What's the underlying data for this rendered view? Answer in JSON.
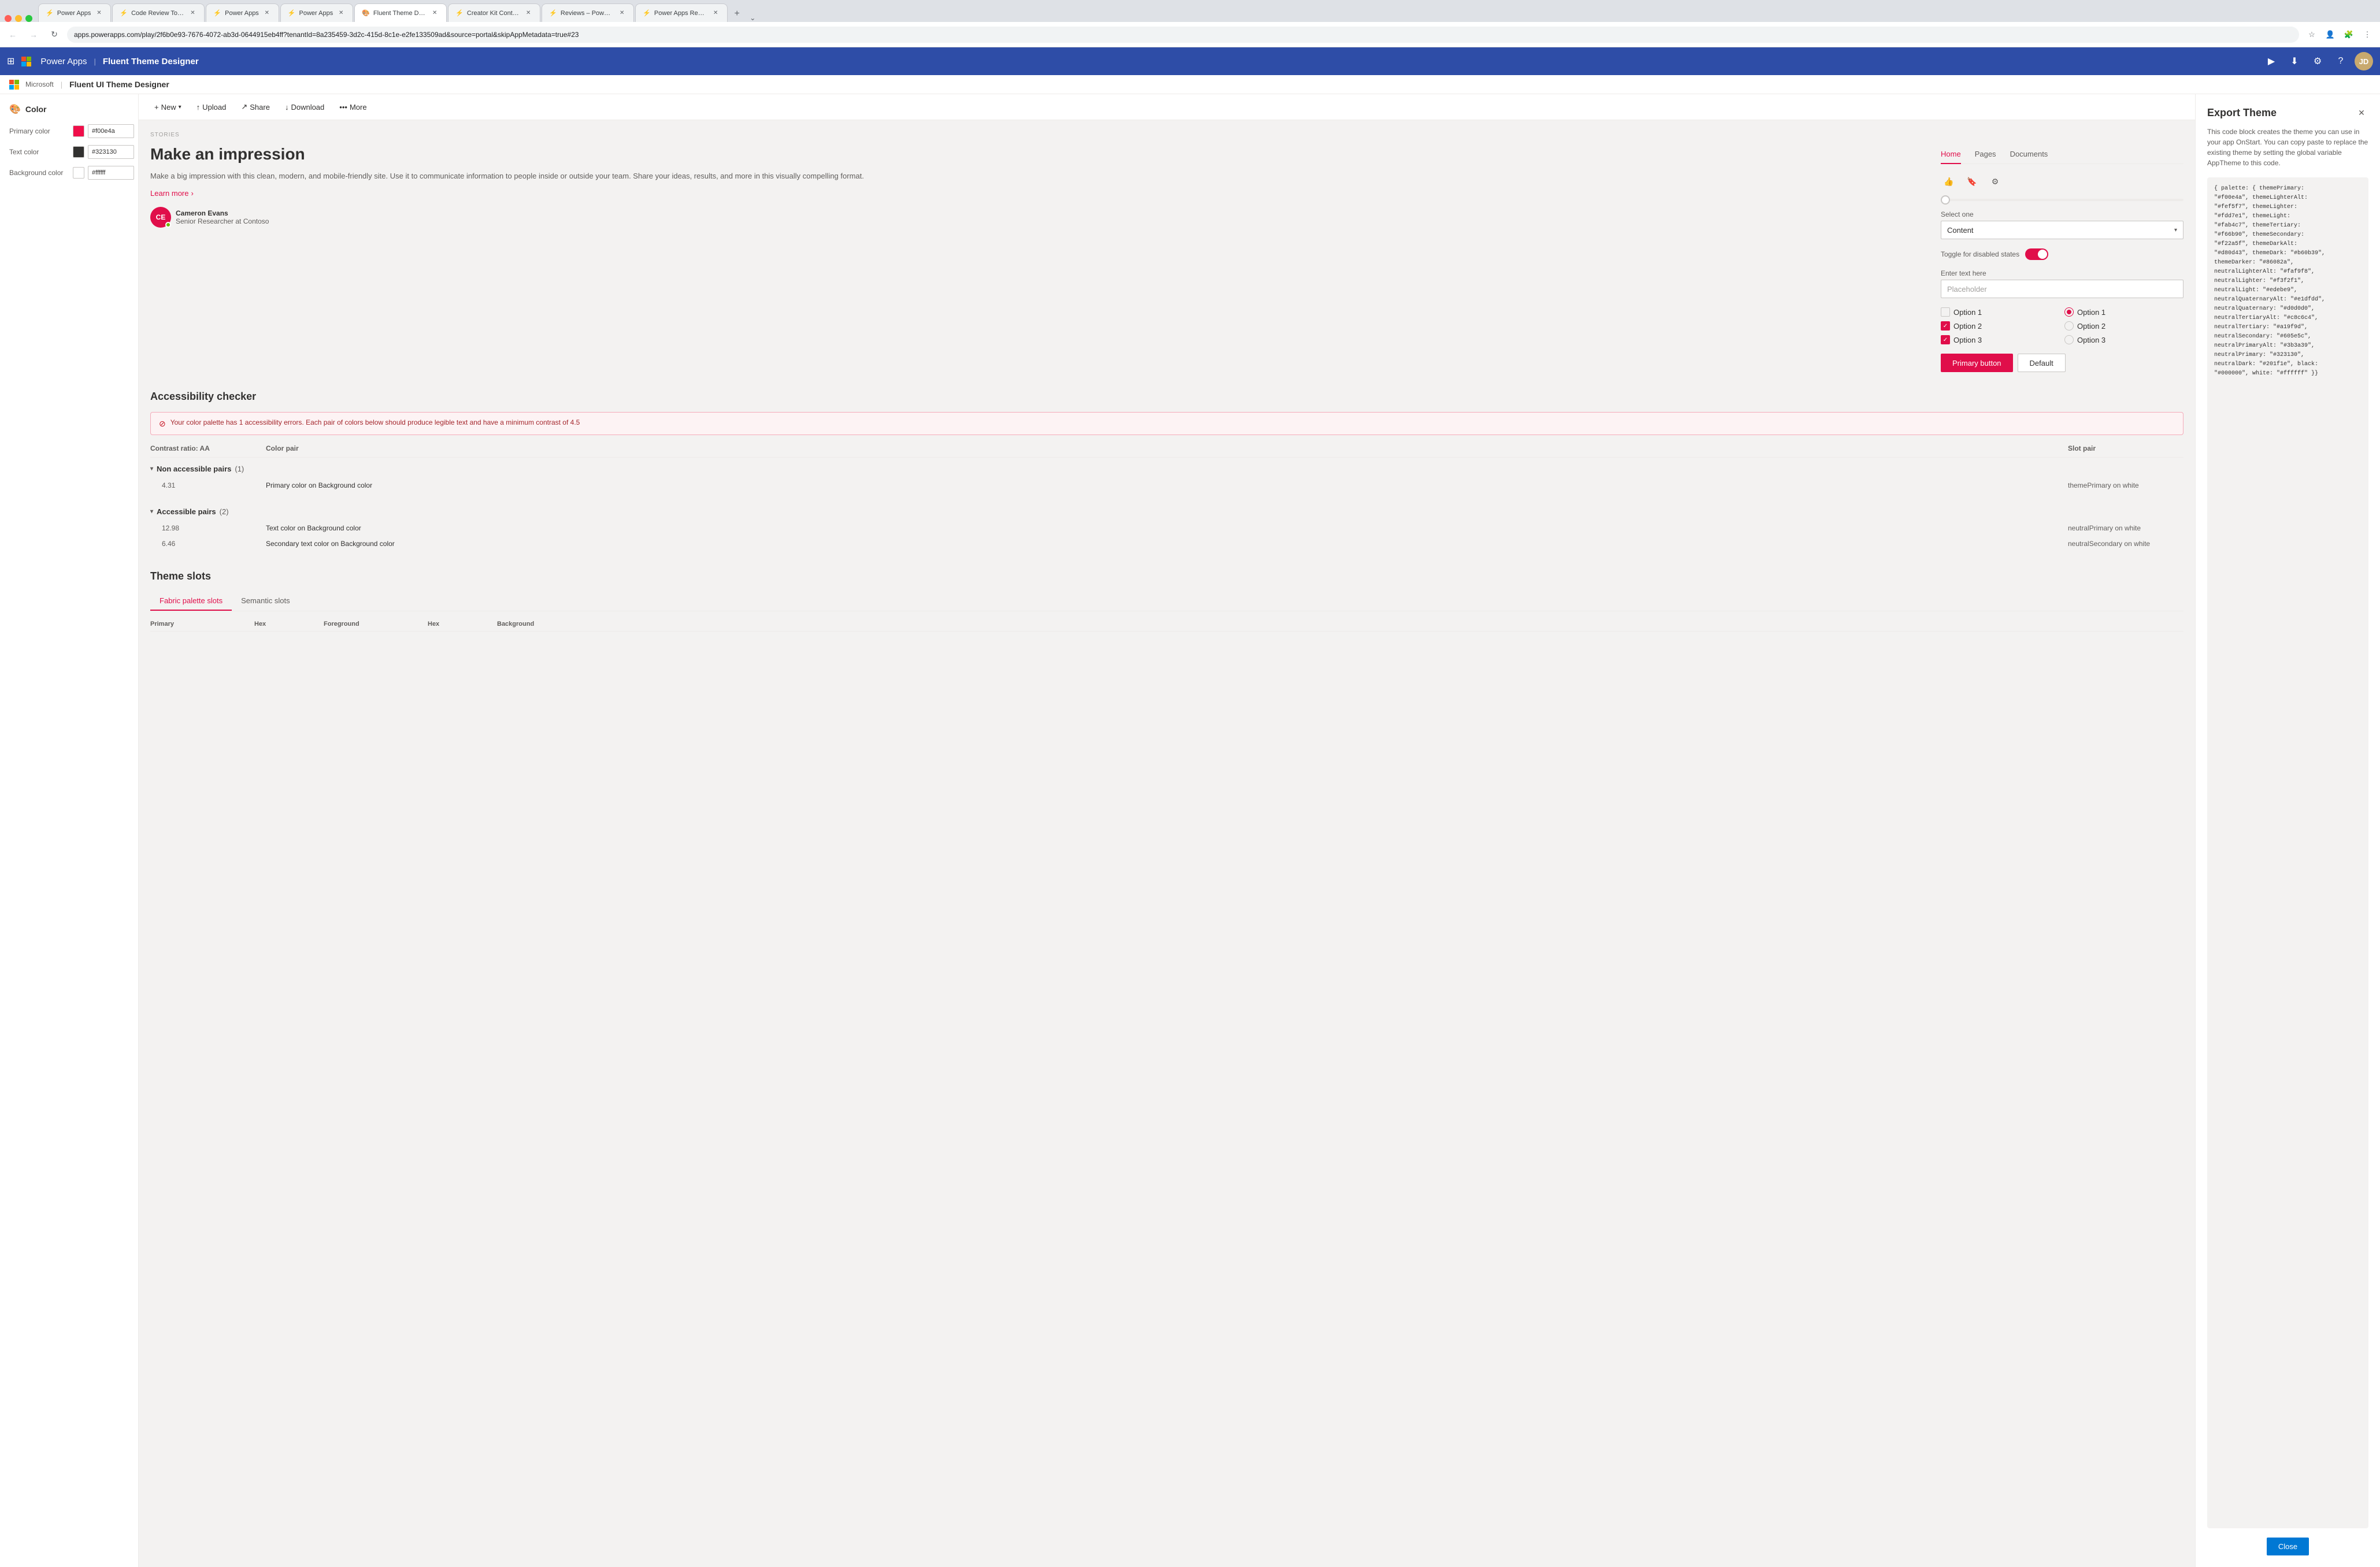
{
  "browser": {
    "tabs": [
      {
        "id": "t1",
        "title": "Power Apps",
        "favicon": "⚡",
        "active": false
      },
      {
        "id": "t2",
        "title": "Code Review Tool Experim...",
        "favicon": "⚡",
        "active": false
      },
      {
        "id": "t3",
        "title": "Power Apps",
        "favicon": "⚡",
        "active": false
      },
      {
        "id": "t4",
        "title": "Power Apps",
        "favicon": "⚡",
        "active": false
      },
      {
        "id": "t5",
        "title": "Fluent Theme Designer -...",
        "favicon": "🎨",
        "active": true
      },
      {
        "id": "t6",
        "title": "Creator Kit Control Refere...",
        "favicon": "⚡",
        "active": false
      },
      {
        "id": "t7",
        "title": "Reviews – Power Apps",
        "favicon": "⚡",
        "active": false
      },
      {
        "id": "t8",
        "title": "Power Apps Review Tool -...",
        "favicon": "⚡",
        "active": false
      }
    ],
    "address": "apps.powerapps.com/play/2f6b0e93-7676-4072-ab3d-0644915eb4ff?tenantId=8a235459-3d2c-415d-8c1e-e2fe133509ad&source=portal&skipAppMetadata=true#23"
  },
  "topnav": {
    "app_title": "Power Apps",
    "separator": "|",
    "page_title": "Fluent Theme Designer"
  },
  "left_panel": {
    "section_title": "Color",
    "colors": [
      {
        "label": "Primary color",
        "value": "#f00e4a",
        "swatch": "#f00e4a"
      },
      {
        "label": "Text color",
        "value": "#323130",
        "swatch": "#323130"
      },
      {
        "label": "Background color",
        "value": "#ffffff",
        "swatch": "#ffffff"
      }
    ]
  },
  "toolbar": {
    "new_label": "New",
    "upload_label": "Upload",
    "share_label": "Share",
    "download_label": "Download",
    "more_label": "More"
  },
  "canvas": {
    "stories_label": "STORIES",
    "headline": "Make an impression",
    "body_text": "Make a big impression with this clean, modern, and mobile-friendly site. Use it to communicate information to people inside or outside your team. Share your ideas, results, and more in this visually compelling format.",
    "learn_more": "Learn more",
    "avatar": {
      "initials": "CE",
      "name": "Cameron Evans",
      "role": "Senior Researcher at Contoso"
    },
    "form": {
      "select_label": "Select one",
      "select_value": "Content",
      "text_label": "Enter text here",
      "text_placeholder": "Placeholder",
      "toggle_label": "Toggle for disabled states"
    },
    "options": [
      {
        "type": "checkbox",
        "checked": false,
        "label": "Option 1",
        "side": "left"
      },
      {
        "type": "radio",
        "checked": true,
        "label": "Option 1",
        "side": "right"
      },
      {
        "type": "checkbox",
        "checked": true,
        "label": "Option 2",
        "side": "left"
      },
      {
        "type": "radio",
        "checked": false,
        "label": "Option 2",
        "side": "right"
      },
      {
        "type": "checkbox",
        "checked": true,
        "label": "Option 3",
        "side": "left"
      },
      {
        "type": "radio",
        "checked": false,
        "label": "Option 3",
        "side": "right"
      }
    ],
    "primary_button_label": "Primary button",
    "default_button_label": "Default",
    "pivot_items": [
      {
        "label": "Home",
        "active": true
      },
      {
        "label": "Pages",
        "active": false
      },
      {
        "label": "Documents",
        "active": false
      }
    ]
  },
  "accessibility": {
    "title": "Accessibility checker",
    "error_msg": "Your color palette has 1 accessibility errors. Each pair of colors below should produce legible text and have a minimum contrast of 4.5",
    "columns": [
      "Contrast ratio: AA",
      "Color pair",
      "Slot pair"
    ],
    "non_accessible": {
      "label": "Non accessible pairs (1)",
      "count": 1,
      "rows": [
        {
          "ratio": "4.31",
          "color_pair": "Primary color on Background color",
          "slot_pair": "themePrimary on white"
        }
      ]
    },
    "accessible": {
      "label": "Accessible pairs (2)",
      "count": 2,
      "rows": [
        {
          "ratio": "12.98",
          "color_pair": "Text color on Background color",
          "slot_pair": "neutralPrimary on white"
        },
        {
          "ratio": "6.46",
          "color_pair": "Secondary text color on Background color",
          "slot_pair": "neutralSecondary on white"
        }
      ]
    }
  },
  "theme_slots": {
    "title": "Theme slots",
    "tabs": [
      "Fabric palette slots",
      "Semantic slots"
    ],
    "active_tab": "Fabric palette slots",
    "columns": [
      "Primary",
      "Hex",
      "Foreground",
      "Hex",
      "Background"
    ]
  },
  "export_panel": {
    "title": "Export Theme",
    "description": "This code block creates the theme you can use in your app OnStart. You can copy paste to replace the existing theme by setting the global variable AppTheme to this code.",
    "code": "{ palette: { themePrimary:\n\"#f00e4a\", themeLighterAlt:\n\"#fef5f7\", themeLighter:\n\"#fdd7e1\", themeLight:\n\"#fab4c7\", themeTertiary:\n\"#f66b90\", themeSecondary:\n\"#f22a5f\", themeDarkAlt:\n\"#d80d43\", themeDark: \"#b60b39\",\nthemeDarker: \"#86082a\",\nneutralLighterAlt: \"#faf9f8\",\nneutralLighter: \"#f3f2f1\",\nneutralLight: \"#edebe9\",\nneutralQuaternaryAlt: \"#e1dfdd\",\nneutralQuaternary: \"#d0d0d0\",\nneutralTertiaryAlt: \"#c8c6c4\",\nneutralTertiary: \"#a19f9d\",\nneutralSecondary: \"#605e5c\",\nneutralPrimaryAlt: \"#3b3a39\",\nneutralPrimary: \"#323130\",\nneutralDark: \"#201f1e\", black:\n\"#000000\", white: \"#ffffff\" }}",
    "close_btn_label": "Close"
  }
}
